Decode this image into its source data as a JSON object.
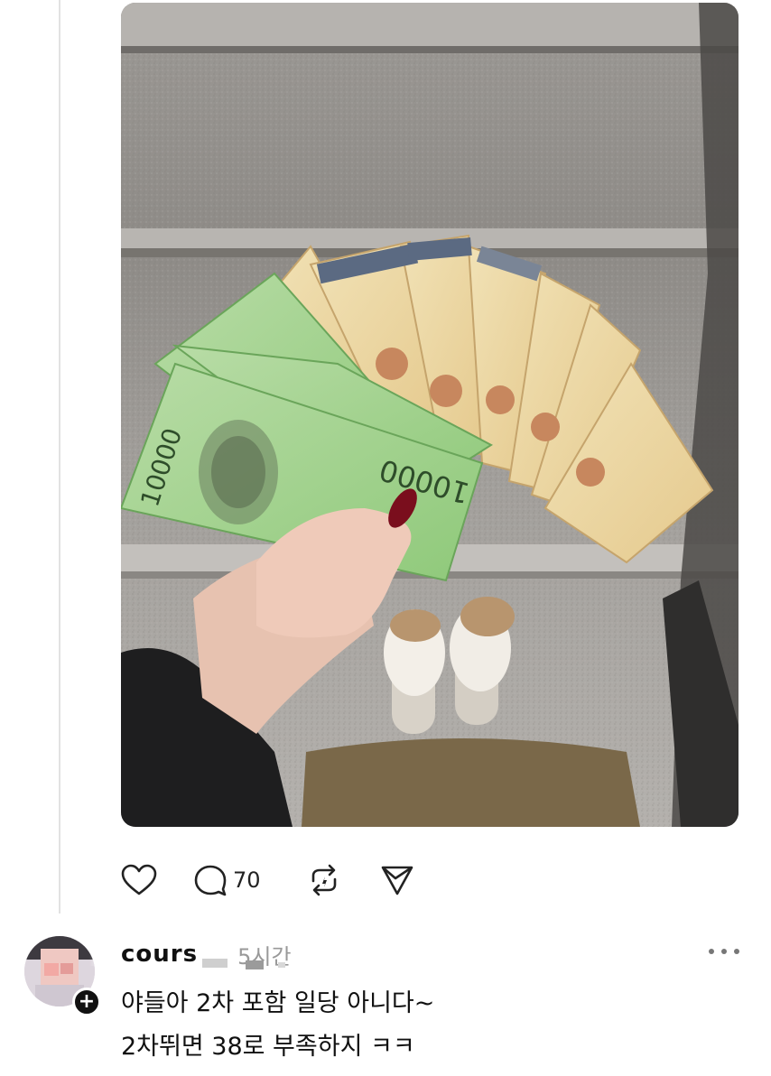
{
  "post": {
    "image": {
      "description_icon": "photo-image"
    },
    "actions": {
      "like_icon": "heart-icon",
      "comment_icon": "speech-bubble-icon",
      "comment_count": "70",
      "repost_icon": "repost-icon",
      "share_icon": "send-icon"
    }
  },
  "reply": {
    "username": "cours",
    "timestamp": "5시간",
    "lines": [
      "야들아 2차 포함 일당 아니다~",
      "2차뛰면 38로 부족하지 ㅋㅋ"
    ],
    "more_icon": "more-options-icon",
    "follow_badge": "+"
  },
  "colors": {
    "thread_line": "#e2e2e2",
    "timestamp": "#999999",
    "text": "#111111"
  }
}
